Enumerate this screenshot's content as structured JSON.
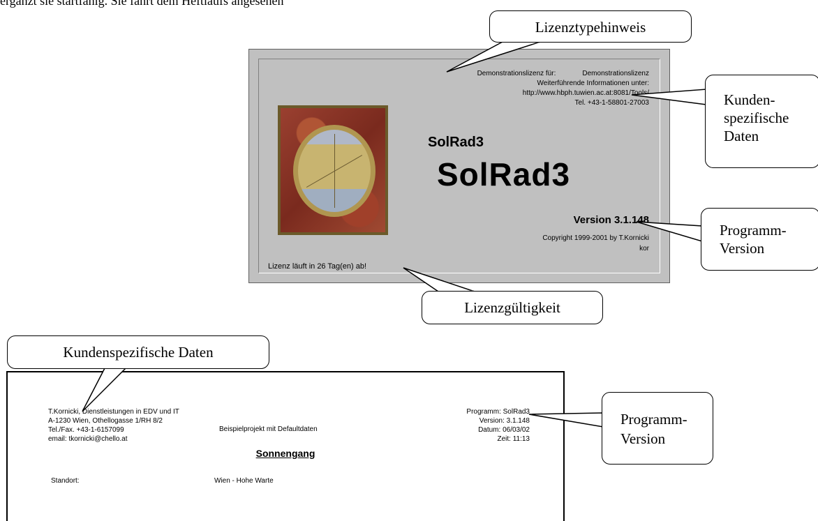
{
  "top_text": "ergänzt sie startfähig. Sie fährt dem Heftlaufs angesehen",
  "splash": {
    "license_label": "Demonstrationslizenz für:",
    "license_value": "Demonstrationslizenz",
    "info_label": "Weiterführende Informationen unter:",
    "url": "http://www.hbph.tuwien.ac.at:8081/Tools/",
    "phone": "Tel. +43-1-58801-27003",
    "app_name_small": "SolRad3",
    "app_name_large": "SolRad3",
    "version": "Version 3.1.148",
    "copyright": "Copyright 1999-2001 by T.Kornicki",
    "user": "kor",
    "license_status": "Lizenz läuft in 26 Tag(en) ab!"
  },
  "callouts": {
    "license_type": "Lizenztypehinweis",
    "customer_data_lines": [
      "Kunden-",
      "spezifische",
      "Daten"
    ],
    "program_version_lines": [
      "Programm-",
      "Version"
    ],
    "license_validity": "Lizenzgültigkeit",
    "customer_data_report": "Kundenspezifische Daten",
    "program_version_report_lines": [
      "Programm-",
      "Version"
    ]
  },
  "report": {
    "company_lines": [
      "T.Kornicki, Dienstleistungen in EDV und IT",
      "A-1230 Wien, Othellogasse 1/RH 8/2",
      "Tel./Fax. +43-1-6157099",
      "email: tkornicki@chello.at"
    ],
    "project": "Beispielprojekt mit Defaultdaten",
    "program": "Programm: SolRad3",
    "version": "Version: 3.1.148",
    "date": "Datum: 06/03/02",
    "time": "Zeit: 11:13",
    "section_title": "Sonnengang",
    "location_label": "Standort:",
    "location_value": "Wien - Hohe Warte"
  }
}
